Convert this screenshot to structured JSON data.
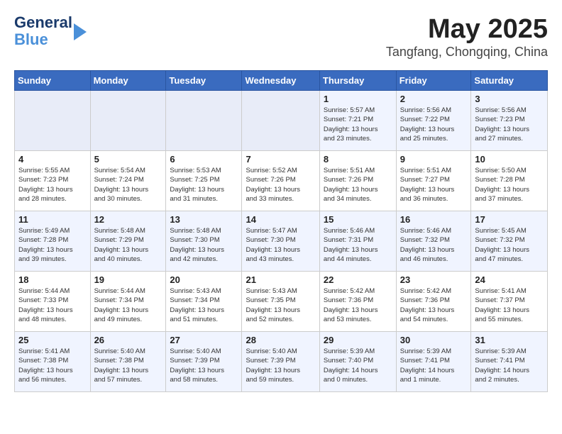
{
  "header": {
    "logo_line1": "General",
    "logo_line2": "Blue",
    "title": "May 2025",
    "subtitle": "Tangfang, Chongqing, China"
  },
  "days_of_week": [
    "Sunday",
    "Monday",
    "Tuesday",
    "Wednesday",
    "Thursday",
    "Friday",
    "Saturday"
  ],
  "weeks": [
    [
      {
        "day": "",
        "info": ""
      },
      {
        "day": "",
        "info": ""
      },
      {
        "day": "",
        "info": ""
      },
      {
        "day": "",
        "info": ""
      },
      {
        "day": "1",
        "info": "Sunrise: 5:57 AM\nSunset: 7:21 PM\nDaylight: 13 hours\nand 23 minutes."
      },
      {
        "day": "2",
        "info": "Sunrise: 5:56 AM\nSunset: 7:22 PM\nDaylight: 13 hours\nand 25 minutes."
      },
      {
        "day": "3",
        "info": "Sunrise: 5:56 AM\nSunset: 7:23 PM\nDaylight: 13 hours\nand 27 minutes."
      }
    ],
    [
      {
        "day": "4",
        "info": "Sunrise: 5:55 AM\nSunset: 7:23 PM\nDaylight: 13 hours\nand 28 minutes."
      },
      {
        "day": "5",
        "info": "Sunrise: 5:54 AM\nSunset: 7:24 PM\nDaylight: 13 hours\nand 30 minutes."
      },
      {
        "day": "6",
        "info": "Sunrise: 5:53 AM\nSunset: 7:25 PM\nDaylight: 13 hours\nand 31 minutes."
      },
      {
        "day": "7",
        "info": "Sunrise: 5:52 AM\nSunset: 7:26 PM\nDaylight: 13 hours\nand 33 minutes."
      },
      {
        "day": "8",
        "info": "Sunrise: 5:51 AM\nSunset: 7:26 PM\nDaylight: 13 hours\nand 34 minutes."
      },
      {
        "day": "9",
        "info": "Sunrise: 5:51 AM\nSunset: 7:27 PM\nDaylight: 13 hours\nand 36 minutes."
      },
      {
        "day": "10",
        "info": "Sunrise: 5:50 AM\nSunset: 7:28 PM\nDaylight: 13 hours\nand 37 minutes."
      }
    ],
    [
      {
        "day": "11",
        "info": "Sunrise: 5:49 AM\nSunset: 7:28 PM\nDaylight: 13 hours\nand 39 minutes."
      },
      {
        "day": "12",
        "info": "Sunrise: 5:48 AM\nSunset: 7:29 PM\nDaylight: 13 hours\nand 40 minutes."
      },
      {
        "day": "13",
        "info": "Sunrise: 5:48 AM\nSunset: 7:30 PM\nDaylight: 13 hours\nand 42 minutes."
      },
      {
        "day": "14",
        "info": "Sunrise: 5:47 AM\nSunset: 7:30 PM\nDaylight: 13 hours\nand 43 minutes."
      },
      {
        "day": "15",
        "info": "Sunrise: 5:46 AM\nSunset: 7:31 PM\nDaylight: 13 hours\nand 44 minutes."
      },
      {
        "day": "16",
        "info": "Sunrise: 5:46 AM\nSunset: 7:32 PM\nDaylight: 13 hours\nand 46 minutes."
      },
      {
        "day": "17",
        "info": "Sunrise: 5:45 AM\nSunset: 7:32 PM\nDaylight: 13 hours\nand 47 minutes."
      }
    ],
    [
      {
        "day": "18",
        "info": "Sunrise: 5:44 AM\nSunset: 7:33 PM\nDaylight: 13 hours\nand 48 minutes."
      },
      {
        "day": "19",
        "info": "Sunrise: 5:44 AM\nSunset: 7:34 PM\nDaylight: 13 hours\nand 49 minutes."
      },
      {
        "day": "20",
        "info": "Sunrise: 5:43 AM\nSunset: 7:34 PM\nDaylight: 13 hours\nand 51 minutes."
      },
      {
        "day": "21",
        "info": "Sunrise: 5:43 AM\nSunset: 7:35 PM\nDaylight: 13 hours\nand 52 minutes."
      },
      {
        "day": "22",
        "info": "Sunrise: 5:42 AM\nSunset: 7:36 PM\nDaylight: 13 hours\nand 53 minutes."
      },
      {
        "day": "23",
        "info": "Sunrise: 5:42 AM\nSunset: 7:36 PM\nDaylight: 13 hours\nand 54 minutes."
      },
      {
        "day": "24",
        "info": "Sunrise: 5:41 AM\nSunset: 7:37 PM\nDaylight: 13 hours\nand 55 minutes."
      }
    ],
    [
      {
        "day": "25",
        "info": "Sunrise: 5:41 AM\nSunset: 7:38 PM\nDaylight: 13 hours\nand 56 minutes."
      },
      {
        "day": "26",
        "info": "Sunrise: 5:40 AM\nSunset: 7:38 PM\nDaylight: 13 hours\nand 57 minutes."
      },
      {
        "day": "27",
        "info": "Sunrise: 5:40 AM\nSunset: 7:39 PM\nDaylight: 13 hours\nand 58 minutes."
      },
      {
        "day": "28",
        "info": "Sunrise: 5:40 AM\nSunset: 7:39 PM\nDaylight: 13 hours\nand 59 minutes."
      },
      {
        "day": "29",
        "info": "Sunrise: 5:39 AM\nSunset: 7:40 PM\nDaylight: 14 hours\nand 0 minutes."
      },
      {
        "day": "30",
        "info": "Sunrise: 5:39 AM\nSunset: 7:41 PM\nDaylight: 14 hours\nand 1 minute."
      },
      {
        "day": "31",
        "info": "Sunrise: 5:39 AM\nSunset: 7:41 PM\nDaylight: 14 hours\nand 2 minutes."
      }
    ]
  ]
}
